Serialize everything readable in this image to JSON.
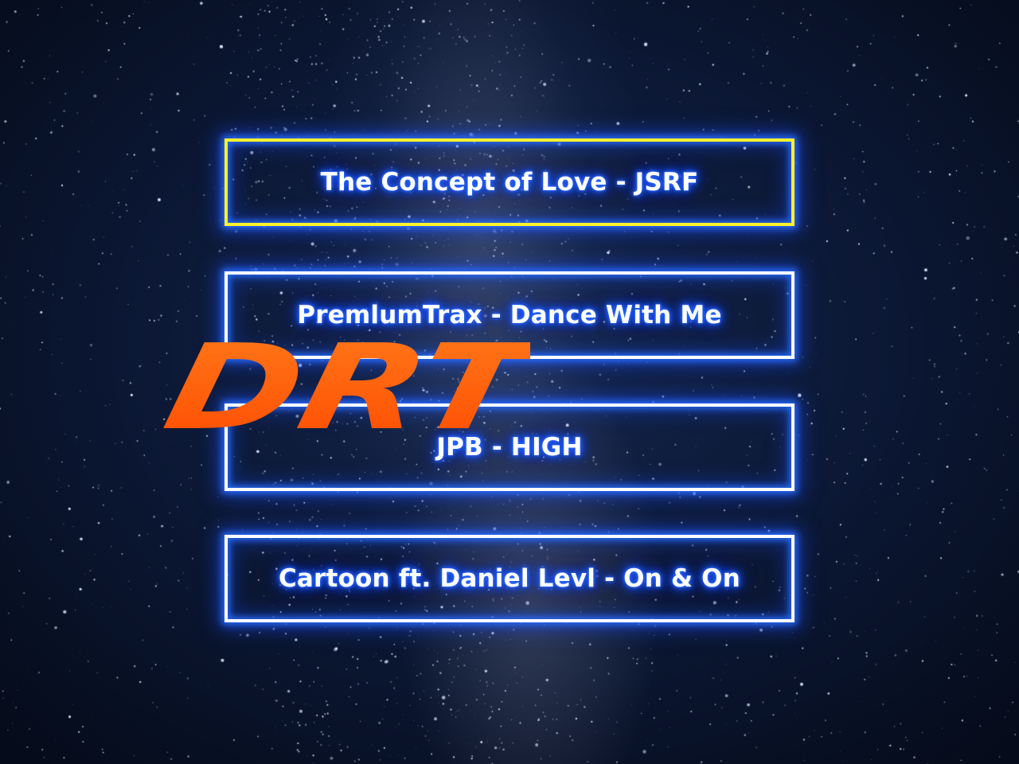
{
  "menu": {
    "tracks": [
      {
        "label": "The Concept of Love - JSRF",
        "selected": true
      },
      {
        "label": "PremlumTrax - Dance With Me",
        "selected": false
      },
      {
        "label": "JPB - HIGH",
        "selected": false
      },
      {
        "label": "Cartoon ft. Daniel Levl - On & On",
        "selected": false
      }
    ]
  },
  "logo": {
    "text": "DRT",
    "color": "#ff5a0a"
  },
  "colors": {
    "selected_border": "#fff22a",
    "border": "#ffffff",
    "glow": "#1d4fff"
  }
}
